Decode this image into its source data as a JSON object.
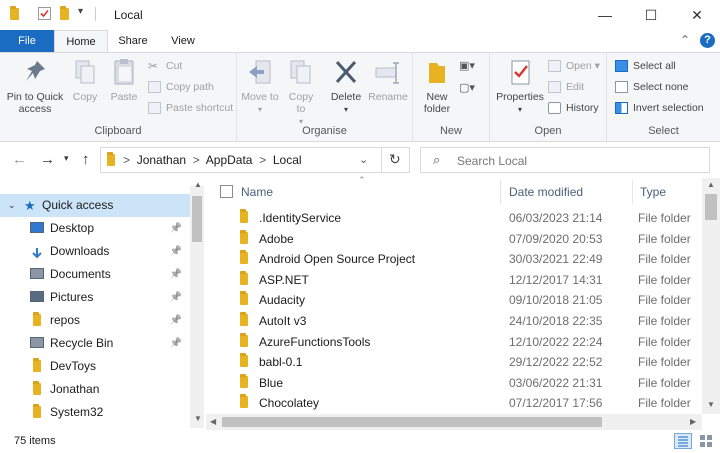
{
  "window": {
    "title": "Local",
    "minimize": "—",
    "maximize": "☐",
    "close": "✕"
  },
  "menu_tabs": {
    "file": "File",
    "home": "Home",
    "share": "Share",
    "view": "View"
  },
  "ribbon": {
    "clipboard": {
      "label": "Clipboard",
      "pin_to_quick_access": "Pin to Quick access",
      "copy": "Copy",
      "paste": "Paste",
      "cut": "Cut",
      "copy_path": "Copy path",
      "paste_shortcut": "Paste shortcut"
    },
    "organise": {
      "label": "Organise",
      "move_to": "Move to",
      "copy_to": "Copy to",
      "delete": "Delete",
      "rename": "Rename"
    },
    "new": {
      "label": "New",
      "new_folder": "New folder"
    },
    "open": {
      "label": "Open",
      "properties": "Properties",
      "open": "Open",
      "edit": "Edit",
      "history": "History"
    },
    "select": {
      "label": "Select",
      "select_all": "Select all",
      "select_none": "Select none",
      "invert_selection": "Invert selection"
    }
  },
  "address": {
    "path_sep": ">",
    "crumbs": [
      "Jonathan",
      "AppData",
      "Local"
    ]
  },
  "search": {
    "placeholder": "Search Local"
  },
  "nav_pane": {
    "quick_access": "Quick access",
    "items": [
      {
        "label": "Desktop",
        "pinned": true,
        "icon": "desktop-icon"
      },
      {
        "label": "Downloads",
        "pinned": true,
        "icon": "download-icon"
      },
      {
        "label": "Documents",
        "pinned": true,
        "icon": "documents-icon"
      },
      {
        "label": "Pictures",
        "pinned": true,
        "icon": "pictures-icon"
      },
      {
        "label": "repos",
        "pinned": true,
        "icon": "folder-icon"
      },
      {
        "label": "Recycle Bin",
        "pinned": true,
        "icon": "recycle-bin-icon"
      },
      {
        "label": "DevToys",
        "pinned": false,
        "icon": "folder-icon"
      },
      {
        "label": "Jonathan",
        "pinned": false,
        "icon": "folder-icon"
      },
      {
        "label": "System32",
        "pinned": false,
        "icon": "folder-icon"
      }
    ]
  },
  "file_list": {
    "columns": {
      "name": "Name",
      "date": "Date modified",
      "type": "Type"
    },
    "rows": [
      {
        "name": ".IdentityService",
        "date": "06/03/2023 21:14",
        "type": "File folder"
      },
      {
        "name": "Adobe",
        "date": "07/09/2020 20:53",
        "type": "File folder"
      },
      {
        "name": "Android Open Source Project",
        "date": "30/03/2021 22:49",
        "type": "File folder"
      },
      {
        "name": "ASP.NET",
        "date": "12/12/2017 14:31",
        "type": "File folder"
      },
      {
        "name": "Audacity",
        "date": "09/10/2018 21:05",
        "type": "File folder"
      },
      {
        "name": "AutoIt v3",
        "date": "24/10/2018 22:35",
        "type": "File folder"
      },
      {
        "name": "AzureFunctionsTools",
        "date": "12/10/2022 22:24",
        "type": "File folder"
      },
      {
        "name": "babl-0.1",
        "date": "29/12/2022 22:52",
        "type": "File folder"
      },
      {
        "name": "Blue",
        "date": "03/06/2022 21:31",
        "type": "File folder"
      },
      {
        "name": "Chocolatey",
        "date": "07/12/2017 17:56",
        "type": "File folder"
      }
    ]
  },
  "status": {
    "item_count": "75 items"
  },
  "colors": {
    "accent": "#1a6bc2",
    "folder": "#e8b323",
    "selection": "#cce4f7"
  }
}
